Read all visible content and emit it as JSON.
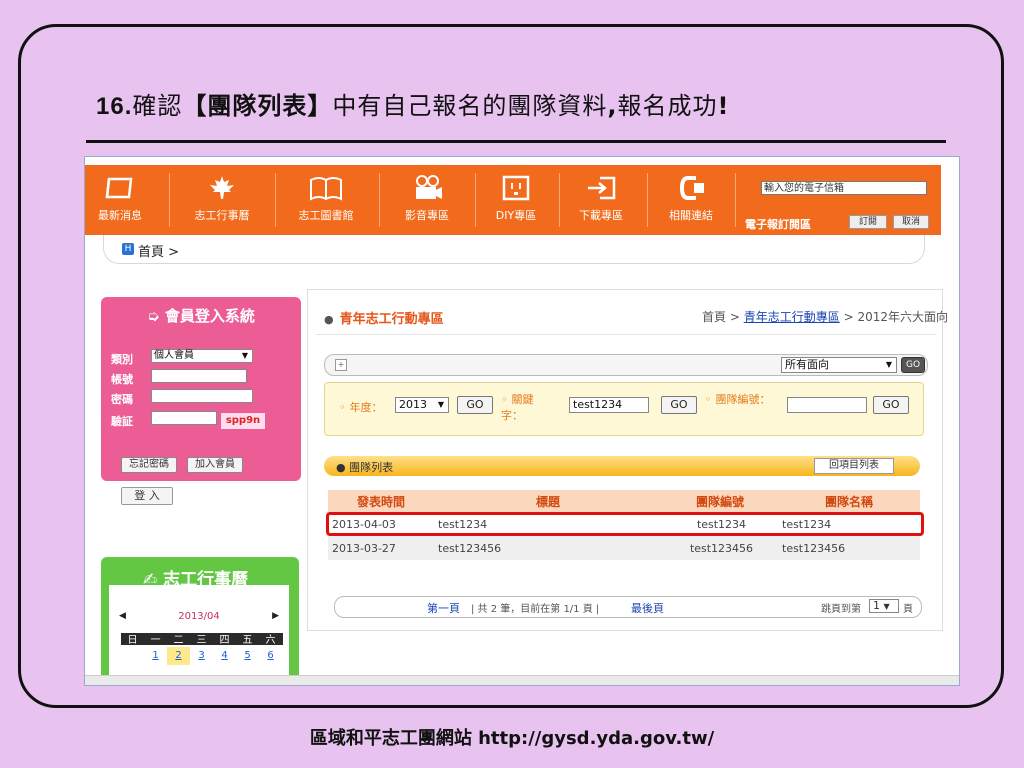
{
  "slide": {
    "step_num": "16.",
    "title_pre": "確認",
    "title_bold": "【團隊列表】",
    "title_post": "中有自己報名的團隊資料",
    "title_comma": ",",
    "title_end": "報名成功",
    "title_bang": "!",
    "footer": "區域和平志工團網站 http://gysd.yda.gov.tw/"
  },
  "nav": {
    "items": [
      {
        "label": "最新消息",
        "icon": "news-icon"
      },
      {
        "label": "志工行事曆",
        "icon": "maple-leaf-icon"
      },
      {
        "label": "志工圖書館",
        "icon": "book-icon"
      },
      {
        "label": "影音專區",
        "icon": "camera-icon"
      },
      {
        "label": "DIY專區",
        "icon": "outlet-icon"
      },
      {
        "label": "下載專區",
        "icon": "download-icon"
      },
      {
        "label": "相關連結",
        "icon": "link-icon"
      }
    ],
    "email_placeholder": "輸入您的電子信箱",
    "newsletter_label": "電子報訂閱區",
    "subscribe": "訂閱",
    "cancel": "取消"
  },
  "breadcrumb": {
    "badge": "H",
    "text": "首頁 >"
  },
  "login": {
    "title": "會員登入系統",
    "type_label": "類別",
    "type_value": "個人會員",
    "account_label": "帳號",
    "password_label": "密碼",
    "verify_label": "驗証",
    "captcha": "spp9n",
    "forgot": "忘記密碼",
    "join": "加入會員",
    "login": "登 入"
  },
  "calendar": {
    "title": "志工行事曆",
    "month": "2013/04",
    "weekdays": [
      "日",
      "一",
      "二",
      "三",
      "四",
      "五",
      "六"
    ],
    "days": [
      "",
      "1",
      "2",
      "3",
      "4",
      "5",
      "6"
    ],
    "today": "2"
  },
  "section": {
    "title": "青年志工行動專區",
    "crumb_home": "首頁 >",
    "crumb_link": "青年志工行動專區",
    "crumb_tail": "> 2012年六大面向"
  },
  "filter": {
    "select": "所有面向",
    "go": "GO"
  },
  "search": {
    "year_label": "年度：",
    "year_value": "2013",
    "keyword_label": "關鍵字：",
    "keyword_value": "test1234",
    "team_no_label": "團隊編號：",
    "team_no_value": "",
    "go": "GO"
  },
  "team_list": {
    "title": "團隊列表",
    "back": "回項目列表",
    "headers": [
      "發表時間",
      "標題",
      "團隊編號",
      "團隊名稱"
    ],
    "rows": [
      [
        "2013-04-03",
        "test1234",
        "test1234",
        "test1234"
      ],
      [
        "2013-03-27",
        "test123456",
        "test123456",
        "test123456"
      ]
    ]
  },
  "pager": {
    "first": "第一頁",
    "info": "| 共 2 筆，目前在第 1/1 頁 |",
    "last": "最後頁",
    "jump_label": "跳頁到第",
    "page": "1",
    "page_suffix": "頁"
  }
}
